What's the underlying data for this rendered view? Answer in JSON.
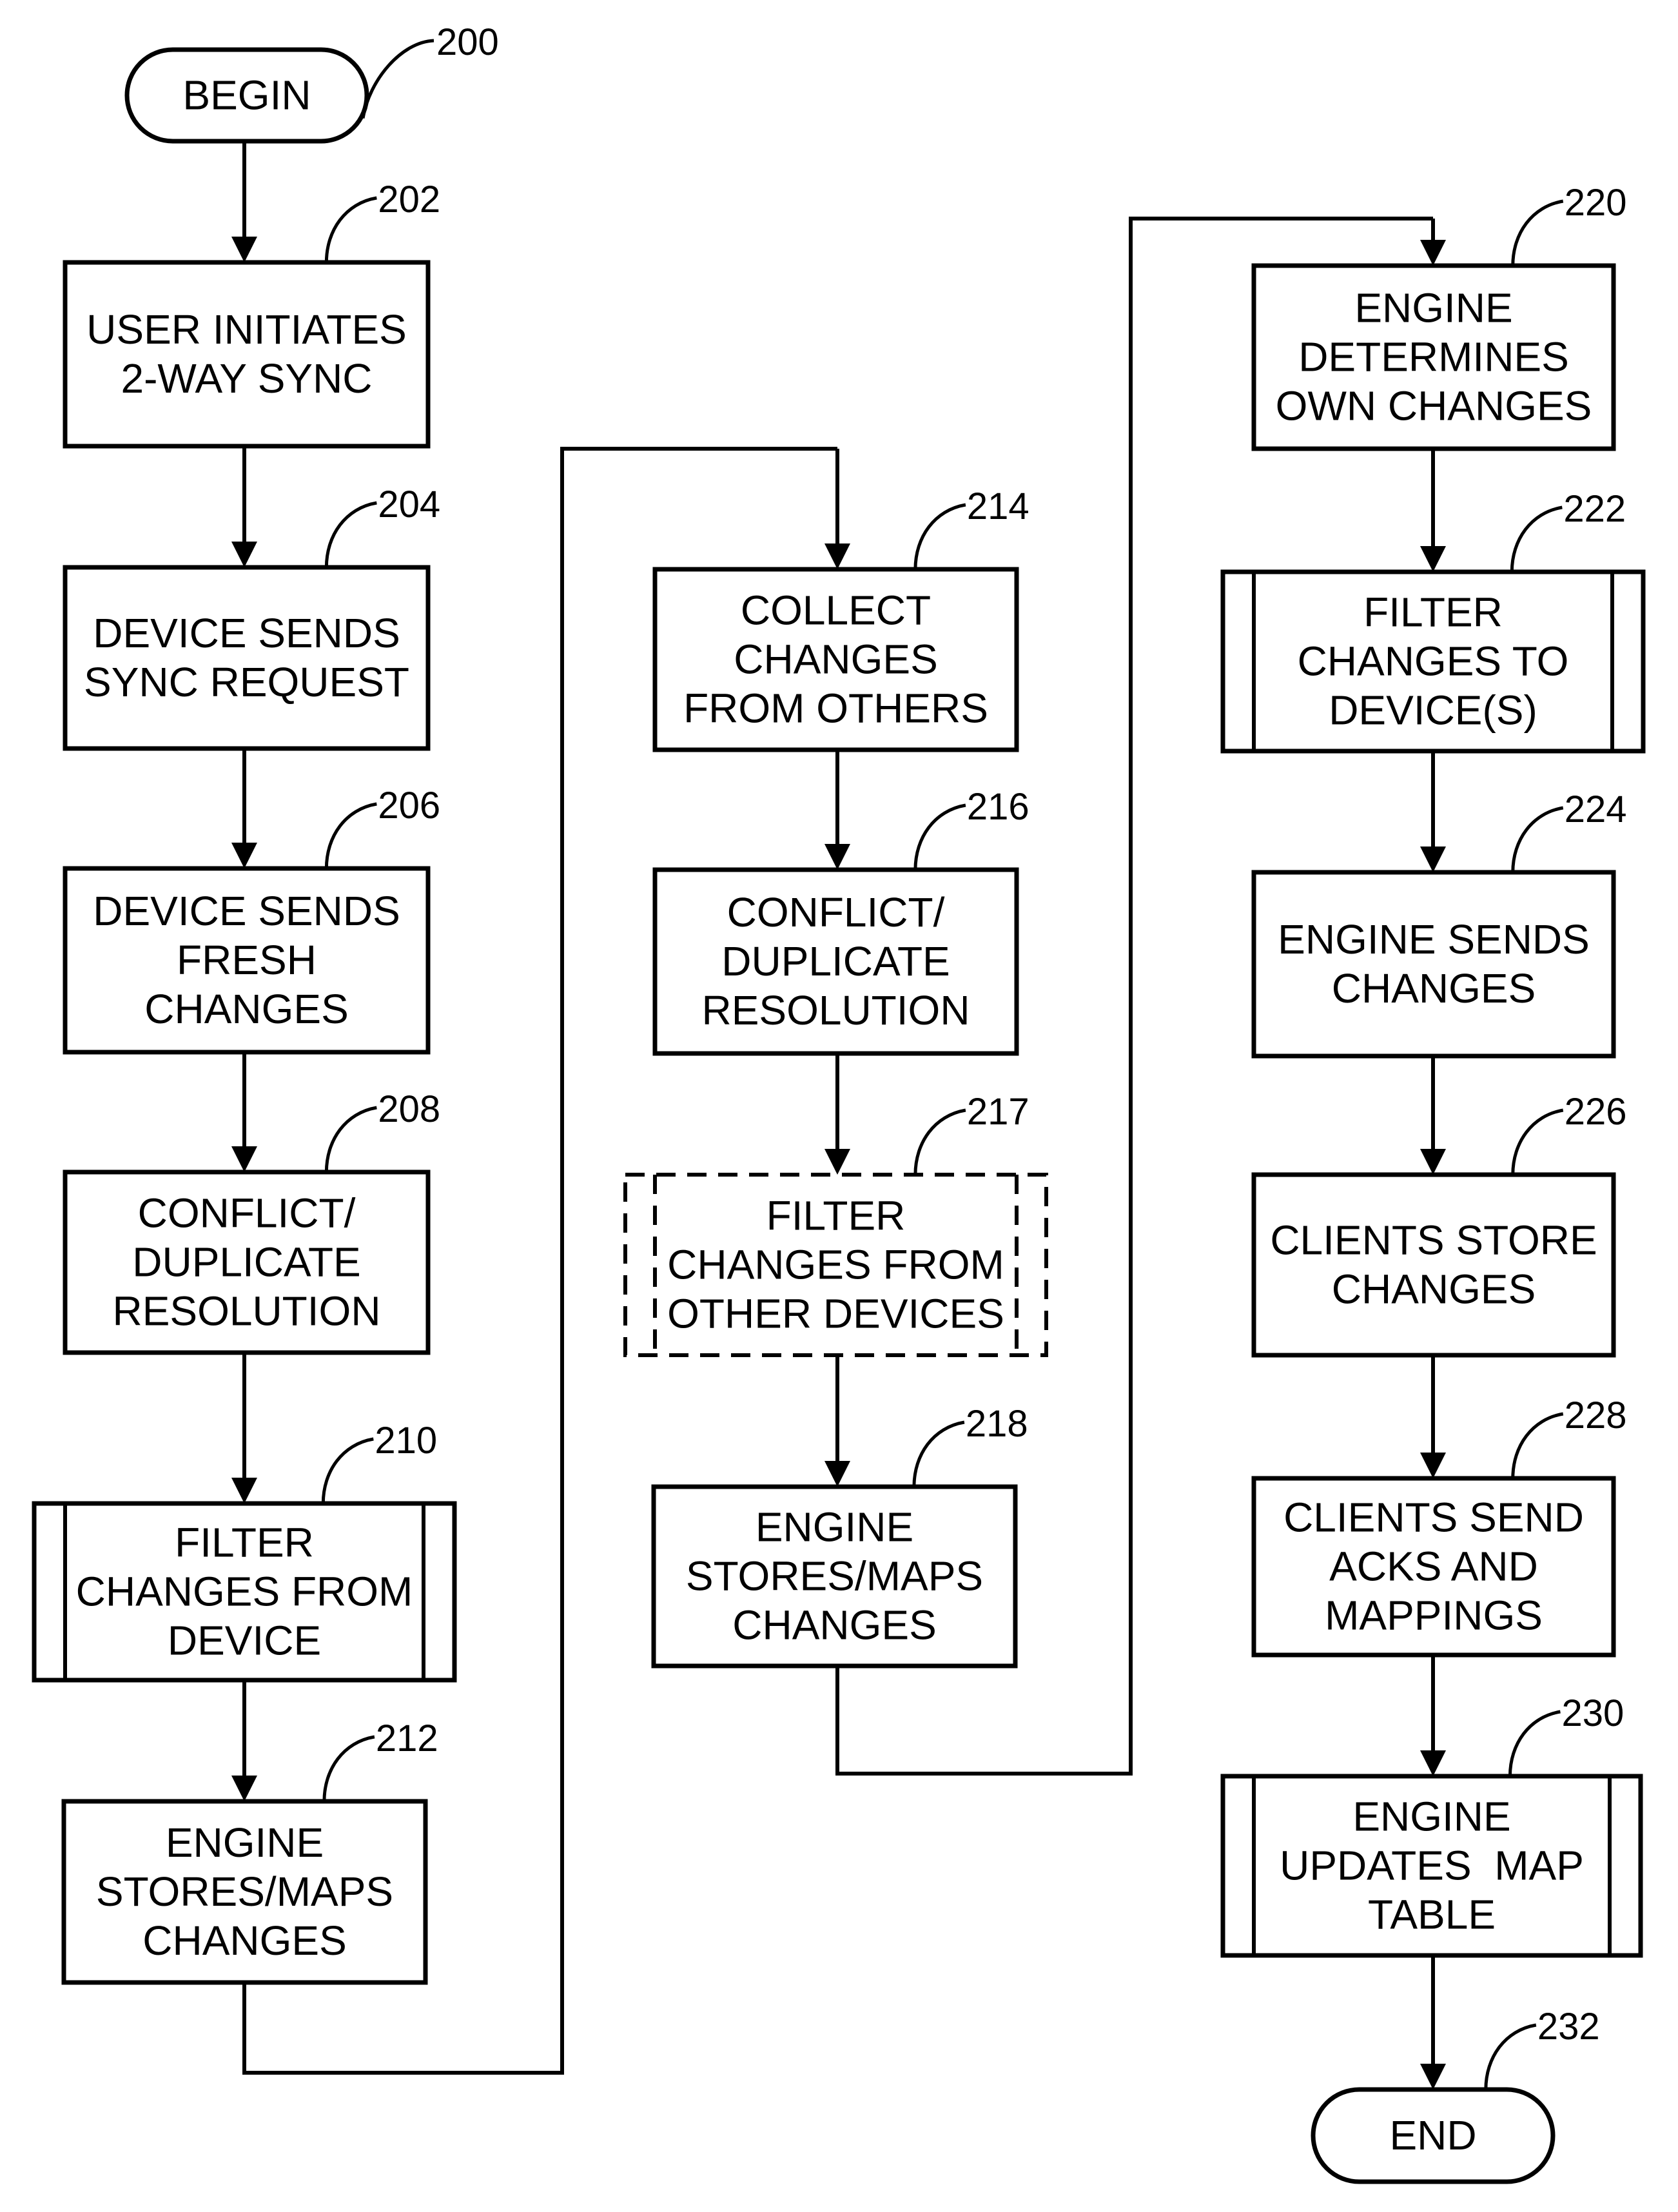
{
  "figure": {
    "type": "flowchart",
    "description": "Two-way sync process flowchart"
  },
  "nodes": [
    {
      "id": "200",
      "shape": "terminator",
      "lines": [
        "BEGIN"
      ]
    },
    {
      "id": "202",
      "shape": "process",
      "lines": [
        "USER INITIATES",
        "2-WAY SYNC"
      ]
    },
    {
      "id": "204",
      "shape": "process",
      "lines": [
        "DEVICE SENDS",
        "SYNC REQUEST"
      ]
    },
    {
      "id": "206",
      "shape": "process",
      "lines": [
        "DEVICE SENDS",
        "FRESH",
        "CHANGES"
      ]
    },
    {
      "id": "208",
      "shape": "process",
      "lines": [
        "CONFLICT/",
        "DUPLICATE",
        "RESOLUTION"
      ]
    },
    {
      "id": "210",
      "shape": "predefined-process",
      "lines": [
        "FILTER",
        "CHANGES FROM",
        "DEVICE"
      ]
    },
    {
      "id": "212",
      "shape": "process",
      "lines": [
        "ENGINE",
        "STORES/MAPS",
        "CHANGES"
      ]
    },
    {
      "id": "214",
      "shape": "process",
      "lines": [
        "COLLECT",
        "CHANGES",
        "FROM OTHERS"
      ]
    },
    {
      "id": "216",
      "shape": "process",
      "lines": [
        "CONFLICT/",
        "DUPLICATE",
        "RESOLUTION"
      ]
    },
    {
      "id": "217",
      "shape": "optional-predefined-process",
      "lines": [
        "FILTER",
        "CHANGES FROM",
        "OTHER DEVICES"
      ]
    },
    {
      "id": "218",
      "shape": "process",
      "lines": [
        "ENGINE",
        "STORES/MAPS",
        "CHANGES"
      ]
    },
    {
      "id": "220",
      "shape": "process",
      "lines": [
        "ENGINE",
        "DETERMINES",
        "OWN CHANGES"
      ]
    },
    {
      "id": "222",
      "shape": "predefined-process",
      "lines": [
        "FILTER",
        "CHANGES TO",
        "DEVICE(S)"
      ]
    },
    {
      "id": "224",
      "shape": "process",
      "lines": [
        "ENGINE SENDS",
        "CHANGES"
      ]
    },
    {
      "id": "226",
      "shape": "process",
      "lines": [
        "CLIENTS STORE",
        "CHANGES"
      ]
    },
    {
      "id": "228",
      "shape": "process",
      "lines": [
        "CLIENTS SEND",
        "ACKS AND",
        "MAPPINGS"
      ]
    },
    {
      "id": "230",
      "shape": "predefined-process",
      "lines": [
        "ENGINE",
        "UPDATES  MAP",
        "TABLE"
      ]
    },
    {
      "id": "232",
      "shape": "terminator",
      "lines": [
        "END"
      ]
    }
  ],
  "edges": [
    [
      "200",
      "202"
    ],
    [
      "202",
      "204"
    ],
    [
      "204",
      "206"
    ],
    [
      "206",
      "208"
    ],
    [
      "208",
      "210"
    ],
    [
      "210",
      "212"
    ],
    [
      "212",
      "214"
    ],
    [
      "214",
      "216"
    ],
    [
      "216",
      "217"
    ],
    [
      "217",
      "218"
    ],
    [
      "218",
      "220"
    ],
    [
      "220",
      "222"
    ],
    [
      "222",
      "224"
    ],
    [
      "224",
      "226"
    ],
    [
      "226",
      "228"
    ],
    [
      "228",
      "230"
    ],
    [
      "230",
      "232"
    ]
  ]
}
